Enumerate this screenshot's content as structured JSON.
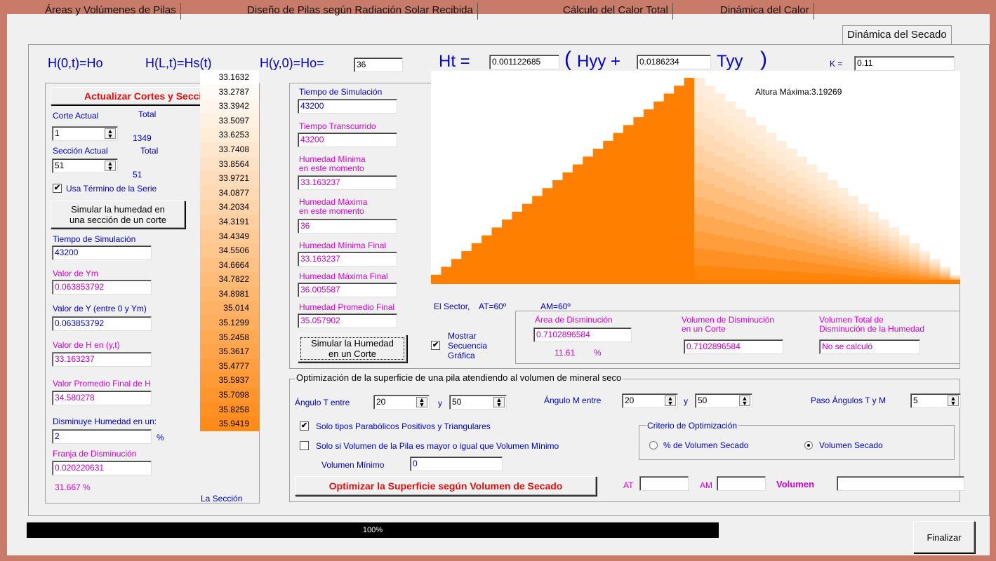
{
  "tabs": [
    {
      "label": "Áreas y Volúmenes de Pilas"
    },
    {
      "label": "Diseño de Pilas según Radiación Solar Recibida"
    },
    {
      "label": "Cálculo del Calor Total"
    },
    {
      "label": "Dinámica del Calor"
    },
    {
      "label": "Dinámica del Secado"
    }
  ],
  "formula": {
    "h0t": "H(0,t)=Ho",
    "hlt": "H(L,t)=Hs(t)",
    "hy0": "H(y,0)=Ho=",
    "ho_value": "36",
    "ht": "Ht =",
    "ht_coef": "0.001122685",
    "paren_open": "(",
    "hyy": "Hyy +",
    "tyy_coef": "0.0186234",
    "tyy": "Tyy",
    "paren_close": ")",
    "k_label": "K =",
    "k_value": "0.11"
  },
  "left": {
    "update_button": "Actualizar Cortes y Secciones",
    "corte_label": "Corte Actual",
    "corte_total_label": "Total",
    "corte_value": "1",
    "corte_total": "1349",
    "seccion_label": "Sección Actual",
    "seccion_total_label": "Total",
    "seccion_value": "51",
    "seccion_total": "51",
    "usa_termino": "Usa Término de la Serie",
    "simular_seccion_btn_1": "Simular la humedad en",
    "simular_seccion_btn_2": "una sección de un corte",
    "tiempo_sim_label": "Tiempo de Simulación",
    "tiempo_sim_value": "43200",
    "ym_label": "Valor de Ym",
    "ym_value": "0.063853792",
    "y_label": "Valor de Y (entre 0 y Ym)",
    "y_value": "0.063853792",
    "h_label": "Valor de H en (y,t)",
    "h_value": "33.163237",
    "hprom_label": "Valor Promedio Final de H",
    "hprom_value": "34.580278",
    "disminuye_label": "Disminuye Humedad en un:",
    "disminuye_value": "2",
    "disminuye_unit": "%",
    "franja_label": "Franja de Disminución",
    "franja_value": "0.020220631",
    "percent_text": "31.667 %"
  },
  "section_values": [
    "33.1632",
    "33.2787",
    "33.3942",
    "33.5097",
    "33.6253",
    "33.7408",
    "33.8564",
    "33.9721",
    "34.0877",
    "34.2034",
    "34.3191",
    "34.4349",
    "34.5506",
    "34.6664",
    "34.7822",
    "34.8981",
    "35.014",
    "35.1299",
    "35.2458",
    "35.3617",
    "35.4777",
    "35.5937",
    "35.7098",
    "35.8258",
    "35.9419"
  ],
  "section_caption": "La Sección",
  "middle": {
    "tiempo_sim_label": "Tiempo de Simulación",
    "tiempo_sim_value": "43200",
    "tiempo_trans_label": "Tiempo Transcurrido",
    "tiempo_trans_value": "43200",
    "hmin_label_1": "Humedad Mínima",
    "hmin_label_2": "en este momento",
    "hmin_value": "33.163237",
    "hmax_label_1": "Humedad Máxima",
    "hmax_label_2": "en este momento",
    "hmax_value": "36",
    "hminf_label": "Humedad Mínima Final",
    "hminf_value": "33.163237",
    "hmaxf_label": "Humedad Máxima Final",
    "hmaxf_value": "36.005587",
    "hpromf_label": "Humedad Promedio Final",
    "hpromf_value": "35.057902",
    "simular_btn_1": "Simular la Humedad",
    "simular_btn_2": "en un Corte",
    "mostrar_1": "Mostrar",
    "mostrar_2": "Secuencia",
    "mostrar_3": "Gráfica"
  },
  "chart": {
    "max_label": "Altura Máxima:3.19269",
    "sector_label": "El Sector,",
    "at_label": "AT=60º",
    "am_label": "AM=60º",
    "steps": 26,
    "max_height": 3.19269,
    "color_dark": "#ff7f00",
    "color_light": "#fff3e6"
  },
  "disminucion": {
    "area_label": "Área de Disminución",
    "area_value": "0.7102896584",
    "area_pct": "11.61",
    "area_pct_unit": "%",
    "vol_label_1": "Volumen de Disminución",
    "vol_label_2": "en un Corte",
    "vol_value": "0.7102896584",
    "voltot_label_1": "Volumen Total de",
    "voltot_label_2": "Disminución de la Humedad",
    "voltot_value": "No se calculó"
  },
  "optim": {
    "title": "Optimización de la superficie de una pila atendiendo al volumen de mineral seco",
    "angT_label": "Ángulo T entre",
    "angT_from": "20",
    "y1": "y",
    "angT_to": "50",
    "angM_label": "Ángulo M entre",
    "angM_from": "20",
    "y2": "y",
    "angM_to": "50",
    "paso_label": "Paso Ángulos T y M",
    "paso_value": "5",
    "solo_tipos": "Solo tipos Parabólicos Positivos y Triangulares",
    "solo_vol": "Solo si Volumen de la Pila es mayor o igual que Volumen Mínimo",
    "vol_min_label": "Volumen Mínimo",
    "vol_min_value": "0",
    "criterio_title": "Criterio de Optimización",
    "criterio_pct": "% de Volumen Secado",
    "criterio_vol": "Volumen Secado",
    "optimizar_btn": "Optimizar la Superficie según Volumen de Secado",
    "at_label": "AT",
    "am_label": "AM",
    "volumen_label": "Volumen"
  },
  "progress": {
    "value": 1.0,
    "text": "100%"
  },
  "finalizar": "Finalizar"
}
